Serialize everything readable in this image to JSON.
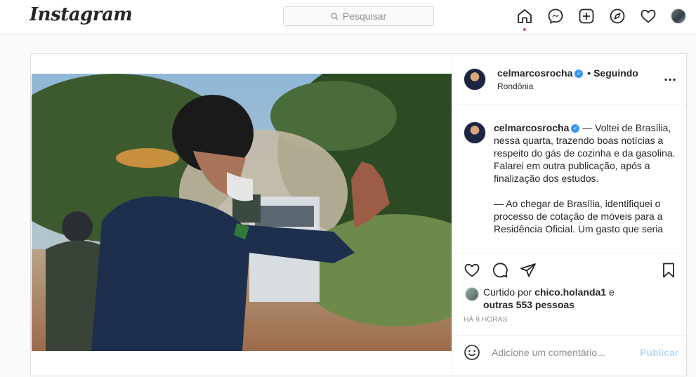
{
  "header": {
    "logo": "Instagram",
    "search_placeholder": "Pesquisar",
    "icons": [
      "home-icon",
      "messenger-icon",
      "new-post-icon",
      "explore-icon",
      "heart-icon",
      "profile-avatar"
    ]
  },
  "post": {
    "username": "celmarcosrocha",
    "follow_status": "• Seguindo",
    "location": "Rondônia",
    "caption": {
      "username": "celmarcosrocha",
      "paragraph1": " — Voltei de Brasília, nessa quarta, trazendo boas notícias a respeito do gás de cozinha e da gasolina. Falarei em outra publicação, após a finalização dos estudos.",
      "paragraph2": "— Ao chegar de Brasília, identifiquei o processo de cotação de móveis para a Residência Oficial. Um gasto que seria"
    },
    "likes": {
      "prefix": "Curtido por ",
      "liker": "chico.holanda1",
      "middle": " e",
      "others": "outras 553 pessoas"
    },
    "time_ago": "HÁ 9 HORAS",
    "comment_placeholder": "Adicione um comentário...",
    "publish_label": "Publicar"
  },
  "colors": {
    "accent": "#3897f0",
    "verified": "#3897f0",
    "notification_dot": "#ed4956"
  }
}
